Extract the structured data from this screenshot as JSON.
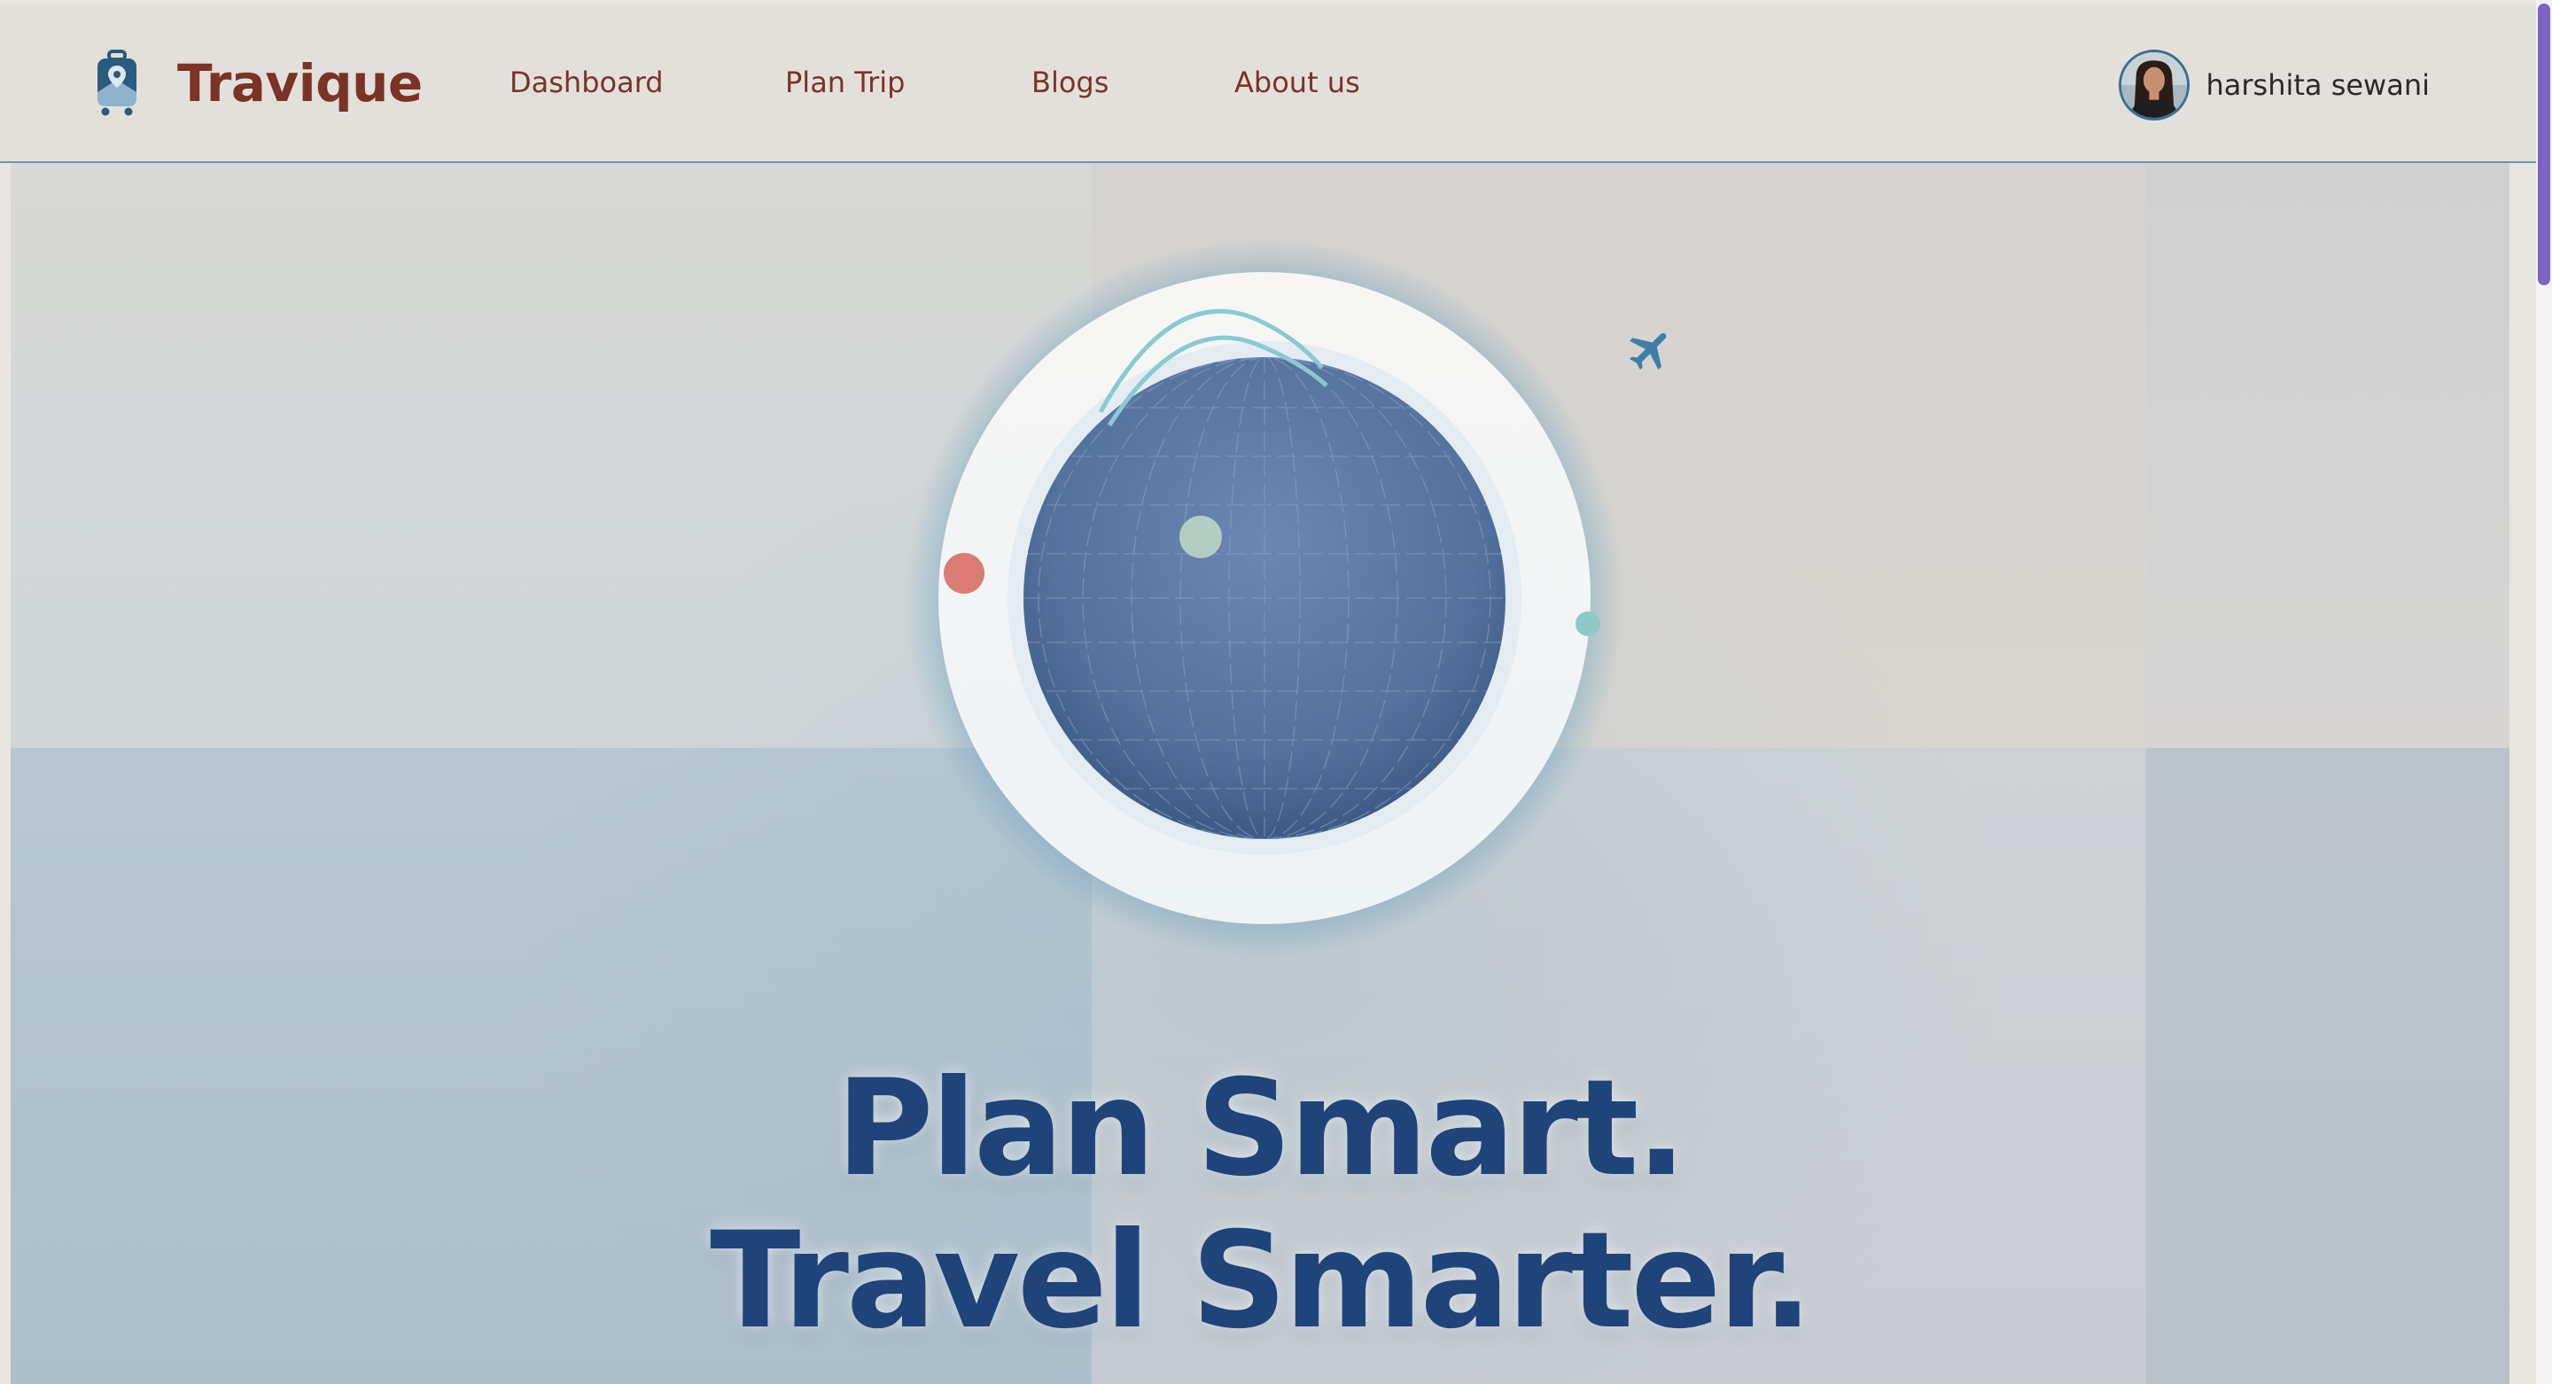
{
  "brand": {
    "name": "Travique",
    "icon": "luggage-pin-icon",
    "color": "#7a3328"
  },
  "nav": {
    "links": [
      {
        "label": "Dashboard"
      },
      {
        "label": "Plan Trip"
      },
      {
        "label": "Blogs"
      },
      {
        "label": "About us"
      }
    ]
  },
  "user": {
    "name": "harshita sewani",
    "avatar": "user-avatar"
  },
  "hero": {
    "headline_line1": "Plan Smart.",
    "headline_line2": "Travel Smarter.",
    "headline_color": "#1f4479",
    "globe_color": "#4f6f9e",
    "decor": [
      "red-dot",
      "mint-dot",
      "teal-dot",
      "airplane-icon",
      "flight-arc"
    ]
  },
  "colors": {
    "accent": "#3d6f92",
    "scroll_thumb": "#7e63c9"
  }
}
